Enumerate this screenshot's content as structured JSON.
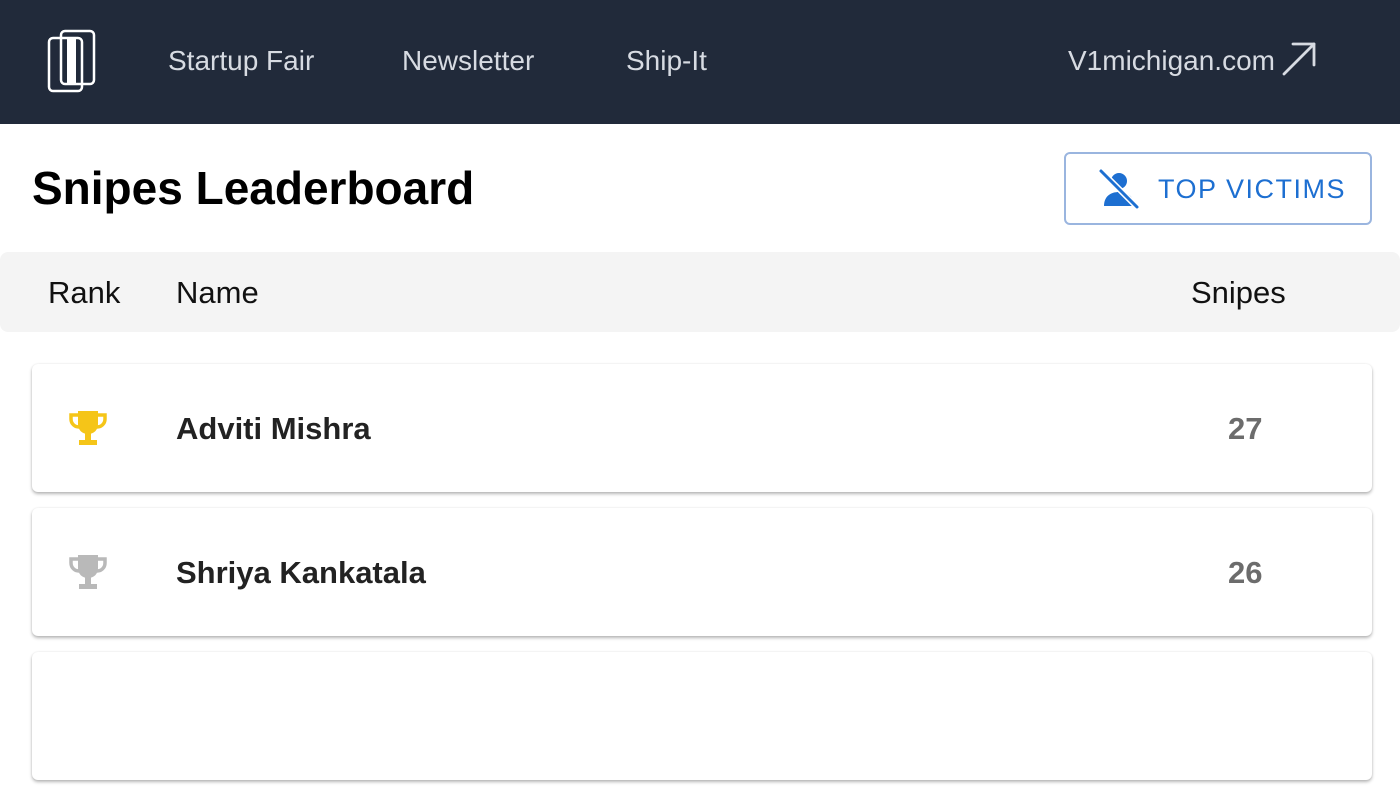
{
  "nav": {
    "links": [
      "Startup Fair",
      "Newsletter",
      "Ship-It"
    ],
    "external_link": "V1michigan.com"
  },
  "page": {
    "title": "Snipes Leaderboard",
    "victims_button": "TOP VICTIMS"
  },
  "table": {
    "headers": {
      "rank": "Rank",
      "name": "Name",
      "snipes": "Snipes"
    },
    "rows": [
      {
        "name": "Adviti Mishra",
        "snipes": "27",
        "trophy_color": "#f5c518"
      },
      {
        "name": "Shriya Kankatala",
        "snipes": "26",
        "trophy_color": "#b9b9b9"
      },
      {
        "name": "",
        "snipes": "",
        "trophy_color": ""
      }
    ]
  },
  "colors": {
    "navbar_bg": "#212a3a",
    "accent": "#1d6fd1",
    "gold": "#f5c518",
    "silver": "#b9b9b9"
  },
  "icons": {
    "logo": "v1-logo-icon",
    "external": "arrow-up-right-icon",
    "victims": "person-off-icon",
    "trophy": "trophy-icon"
  }
}
